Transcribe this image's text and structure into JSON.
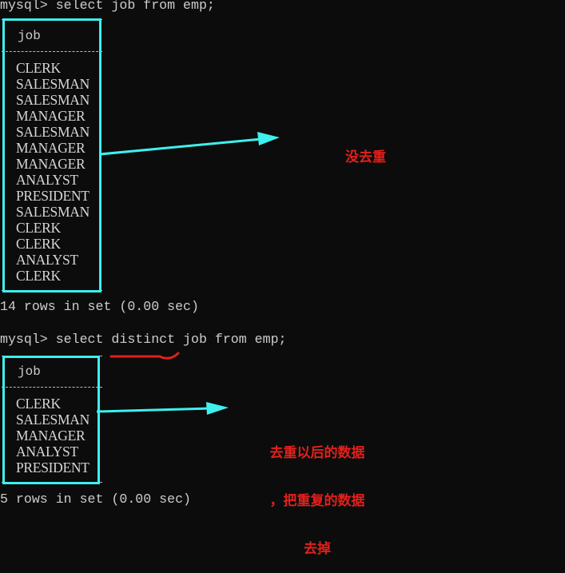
{
  "terminal": {
    "query1": {
      "prompt": "mysql> select job from emp;",
      "column_header": "job",
      "rows": [
        "CLERK",
        "SALESMAN",
        "SALESMAN",
        "MANAGER",
        "SALESMAN",
        "MANAGER",
        "MANAGER",
        "ANALYST",
        "PRESIDENT",
        "SALESMAN",
        "CLERK",
        "CLERK",
        "ANALYST",
        "CLERK"
      ],
      "result_summary": "14 rows in set (0.00 sec)"
    },
    "query2": {
      "prompt": "mysql> select distinct job from emp;",
      "column_header": "job",
      "rows": [
        "CLERK",
        "SALESMAN",
        "MANAGER",
        "ANALYST",
        "PRESIDENT"
      ],
      "result_summary": "5 rows in set (0.00 sec)"
    }
  },
  "annotations": {
    "note1": "没去重",
    "note2_lines": [
      "去重以后的数据",
      "，把重复的数据",
      "去掉"
    ],
    "highlight_color": "#3ef0ee",
    "note_color": "#e3201b"
  }
}
